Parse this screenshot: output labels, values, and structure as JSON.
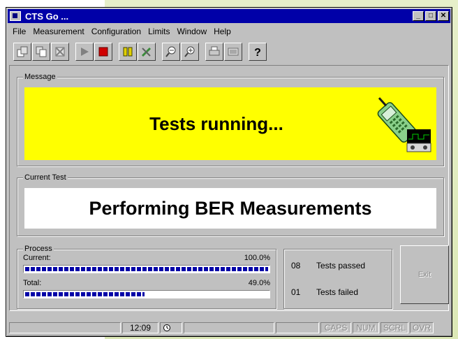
{
  "window": {
    "title": "CTS Go ..."
  },
  "menu": [
    "File",
    "Measurement",
    "Configuration",
    "Limits",
    "Window",
    "Help"
  ],
  "toolbar": {
    "buttons": [
      "open-icon",
      "save-icon",
      "delete-icon",
      "play-icon",
      "stop-icon",
      "pause-icon",
      "tools-icon",
      "zoom-out-icon",
      "zoom-in-icon",
      "print-icon",
      "display-icon",
      "help-icon"
    ]
  },
  "message": {
    "label": "Message",
    "text": "Tests running..."
  },
  "current_test": {
    "label": "Current Test",
    "text": "Performing BER Measurements"
  },
  "process": {
    "label": "Process",
    "current_label": "Current:",
    "current_value": "100.0%",
    "current_fraction": 1.0,
    "total_label": "Total:",
    "total_value": "49.0%",
    "total_fraction": 0.49
  },
  "stats": {
    "passed_count": "08",
    "passed_label": "Tests passed",
    "failed_count": "01",
    "failed_label": "Tests failed"
  },
  "exit_label": "Exit",
  "statusbar": {
    "time": "12:09",
    "caps": "CAPS",
    "num": "NUM",
    "scrl": "SCRL",
    "ovr": "OVR"
  },
  "colors": {
    "title_blue": "#0000a8",
    "message_bg": "#ffff00",
    "progress_blue": "#0000a8"
  }
}
